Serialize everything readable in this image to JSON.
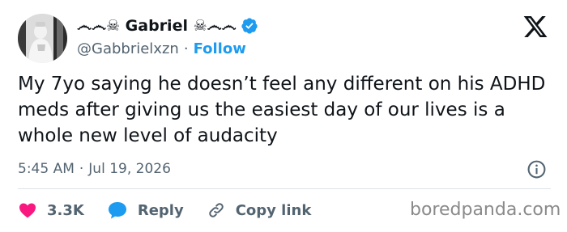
{
  "author": {
    "display_name": "෴෴☠ Gabriel ☠෴෴",
    "handle": "@Gabbrielxzn",
    "separator": "·",
    "follow_label": "Follow",
    "verified": true
  },
  "tweet": {
    "text": "My 7yo saying he doesn’t feel any different on his ADHD meds after giving us the easiest day of our lives is a whole new level of audacity",
    "time": "5:45 AM",
    "date": "Jul 19, 2026"
  },
  "actions": {
    "like_count": "3.3K",
    "reply_label": "Reply",
    "copy_link_label": "Copy link"
  },
  "watermark": "boredpanda.com",
  "colors": {
    "accent": "#1d9bf0",
    "like": "#f91880",
    "text": "#0f1419",
    "secondary": "#536471"
  },
  "icons": {
    "platform": "x-logo-icon",
    "verified": "verified-badge-icon",
    "info": "info-icon",
    "like": "heart-icon",
    "reply": "speech-bubble-icon",
    "copy_link": "link-icon"
  }
}
